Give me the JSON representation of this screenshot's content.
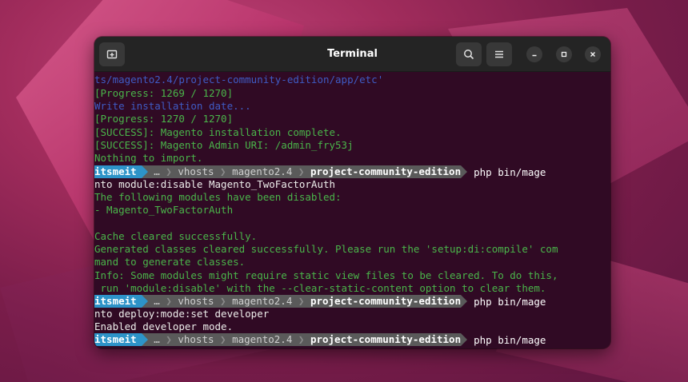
{
  "window": {
    "title": "Terminal"
  },
  "icons": {
    "new_tab": "new-tab-icon",
    "search": "search-icon",
    "menu": "hamburger-menu-icon",
    "minimize": "minimize-icon",
    "maximize": "maximize-icon",
    "close": "close-icon"
  },
  "colors": {
    "terminal_bg": "#300a24",
    "prompt_user_bg": "#2d93c8",
    "prompt_path_bg": "#5a5a5a",
    "output_green": "#4ab54a",
    "output_blue": "#3f5bc4"
  },
  "output": {
    "l1": "ts/magento2.4/project-community-edition/app/etc'",
    "l2": "[Progress: 1269 / 1270]",
    "l3": "Write installation date...",
    "l4": "[Progress: 1270 / 1270]",
    "l5": "[SUCCESS]: Magento installation complete.",
    "l6": "[SUCCESS]: Magento Admin URI: /admin_fry53j",
    "l7": "Nothing to import.",
    "l9": "nto module:disable Magento_TwoFactorAuth",
    "l10": "The following modules have been disabled:",
    "l11": "- Magento_TwoFactorAuth",
    "l13": "Cache cleared successfully.",
    "l14": "Generated classes cleared successfully. Please run the 'setup:di:compile' com",
    "l15": "mand to generate classes.",
    "l16": "Info: Some modules might require static view files to be cleared. To do this,",
    "l17": " run 'module:disable' with the --clear-static-content option to clear them.",
    "l19": "nto deploy:mode:set developer",
    "l20": "Enabled developer mode."
  },
  "prompt": {
    "user": "itsmeit",
    "ellipsis": "…",
    "dir1": "vhosts",
    "dir2": "magento2.4",
    "current": "project-community-edition",
    "command": "php bin/mage"
  }
}
